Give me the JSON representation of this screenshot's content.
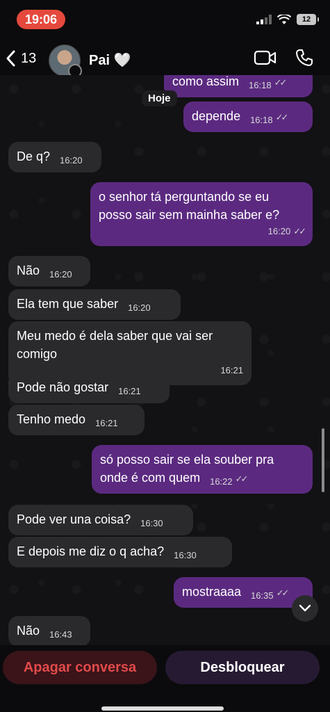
{
  "status": {
    "time": "19:06",
    "battery": "12"
  },
  "header": {
    "unread_count": "13",
    "contact_name": "Pai",
    "heart": "🤍"
  },
  "day_label": "Hoje",
  "messages": [
    {
      "text": "como assim",
      "time": "16:18",
      "dir": "out"
    },
    {
      "text": "depende",
      "time": "16:18",
      "dir": "out"
    },
    {
      "text": "De q?",
      "time": "16:20",
      "dir": "in"
    },
    {
      "text": "o senhor tá perguntando se eu posso sair sem mainha saber e?",
      "time": "16:20",
      "dir": "out"
    },
    {
      "text": "Não",
      "time": "16:20",
      "dir": "in"
    },
    {
      "text": "Ela tem que saber",
      "time": "16:20",
      "dir": "in"
    },
    {
      "text": "Meu medo é dela saber que vai ser comigo",
      "time": "16:21",
      "dir": "in"
    },
    {
      "text": "Pode não gostar",
      "time": "16:21",
      "dir": "in"
    },
    {
      "text": "Tenho medo",
      "time": "16:21",
      "dir": "in"
    },
    {
      "text": "só posso sair se ela souber pra onde é com quem",
      "time": "16:22",
      "dir": "out"
    },
    {
      "text": "Pode ver una coisa?",
      "time": "16:30",
      "dir": "in"
    },
    {
      "text": "E depois me diz o q acha?",
      "time": "16:30",
      "dir": "in"
    },
    {
      "text": "mostraaaa",
      "time": "16:35",
      "dir": "out"
    },
    {
      "text": "Não",
      "time": "16:43",
      "dir": "in"
    }
  ],
  "footer": {
    "delete_label": "Apagar conversa",
    "unblock_label": "Desbloquear"
  },
  "colors": {
    "outgoing_bubble": "#5b2a80",
    "incoming_bubble": "#2a2a2d",
    "danger": "#e24a4a"
  }
}
